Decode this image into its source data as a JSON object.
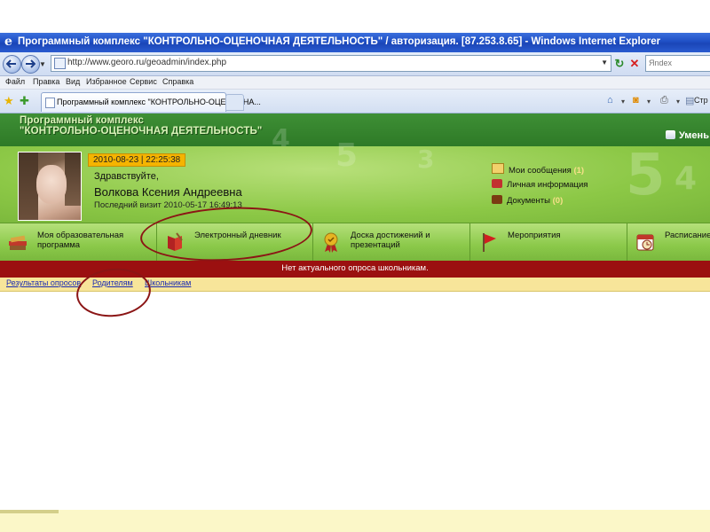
{
  "window": {
    "title": "Программный комплекс \"КОНТРОЛЬНО-ОЦЕНОЧНАЯ ДЕЯТЕЛЬНОСТЬ\" / авторизация. [87.253.8.65] - Windows Internet Explorer"
  },
  "address_bar": {
    "url": "http://www.georo.ru/geoadmin/index.php",
    "search_placeholder": "Яndex"
  },
  "menu": {
    "items": [
      "Файл",
      "Правка",
      "Вид",
      "Избранное",
      "Сервис",
      "Справка"
    ]
  },
  "tabs": {
    "active_tab": "Программный комплекс \"КОНТРОЛЬНО-ОЦЕНОЧНА..."
  },
  "command_bar": {
    "page_label": "Стр"
  },
  "site": {
    "title_line1": "Программный комплекс",
    "title_line2": "\"КОНТРОЛЬНО-ОЦЕНОЧНАЯ ДЕЯТЕЛЬНОСТЬ\"",
    "user_link": "Умень",
    "decor_digits": [
      "4",
      "5",
      "3",
      "5",
      "4"
    ]
  },
  "profile": {
    "datetime": "2010-08-23 | 22:25:38",
    "greeting": "Здравствуйте,",
    "name": "Волкова Ксения Андреевна",
    "last_visit": "Последний визит 2010-05-17 16:49:13"
  },
  "quick_links": [
    {
      "label": "Мои сообщения",
      "count": "(1)",
      "icon": "envelope-icon"
    },
    {
      "label": "Личная информация",
      "count": "",
      "icon": "profile-card-icon"
    },
    {
      "label": "Документы",
      "count": "(0)",
      "icon": "briefcase-icon"
    }
  ],
  "main_nav": [
    {
      "label": "Моя образовательная программа",
      "icon": "books-icon"
    },
    {
      "label": "Электронный дневник",
      "icon": "diary-icon"
    },
    {
      "label": "Доска достижений и презентаций",
      "icon": "medal-icon"
    },
    {
      "label": "Мероприятия",
      "icon": "flag-icon"
    },
    {
      "label": "Расписание",
      "icon": "clock-icon"
    }
  ],
  "alert": {
    "text": "Нет актуального опроса школьникам."
  },
  "sub_nav": [
    "Результаты опросов",
    "Родителям",
    "Школьникам"
  ],
  "colors": {
    "header_green": "#2e7a27",
    "band_green": "#8cc846",
    "alert_red": "#9b1010",
    "badge_orange": "#f5b400",
    "subnav_yellow": "#f7e59a",
    "annotation_red": "#8b1515"
  }
}
